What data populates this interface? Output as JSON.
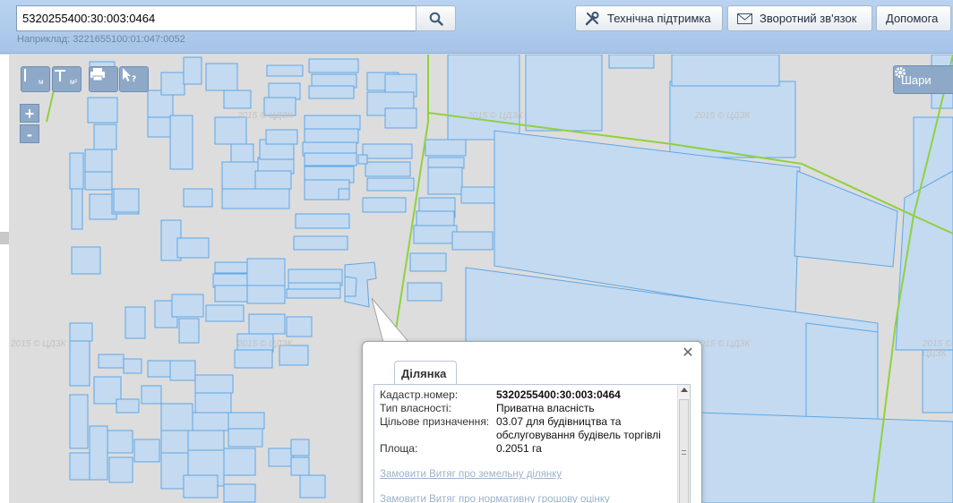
{
  "search": {
    "value": "5320255400:30:003:0464",
    "hint": "Наприклад: 3221655100:01:047:0052"
  },
  "header_buttons": {
    "support": "Технічна підтримка",
    "feedback": "Зворотний зв'язок",
    "help": "Допомога"
  },
  "map": {
    "watermark": "2015 © ЦДЗК",
    "tools": {
      "measure_length_unit": "м",
      "measure_area_unit": "м²"
    },
    "zoom_in": "+",
    "zoom_out": "-",
    "layers_label": "Шари",
    "colors": {
      "parcel_fill": "#c4daf0",
      "parcel_stroke": "#5ea7e6",
      "boundary_line": "#8fd13f",
      "map_background": "#dddddd"
    }
  },
  "popup": {
    "tab": "Ділянка",
    "fields": [
      {
        "label": "Кадастр.номер:",
        "value": "5320255400:30:003:0464",
        "bold": true
      },
      {
        "label": "Тип власності:",
        "value": "Приватна власність"
      },
      {
        "label": "Цільове призначення:",
        "value": "03.07 для будівництва та обслуговування будівель торгівлі"
      },
      {
        "label": "Площа:",
        "value": "0.2051 га"
      }
    ],
    "links": [
      "Замовити Витяг про земельну ділянку",
      "Замовити Витяг про нормативну грошову оцінку"
    ]
  }
}
